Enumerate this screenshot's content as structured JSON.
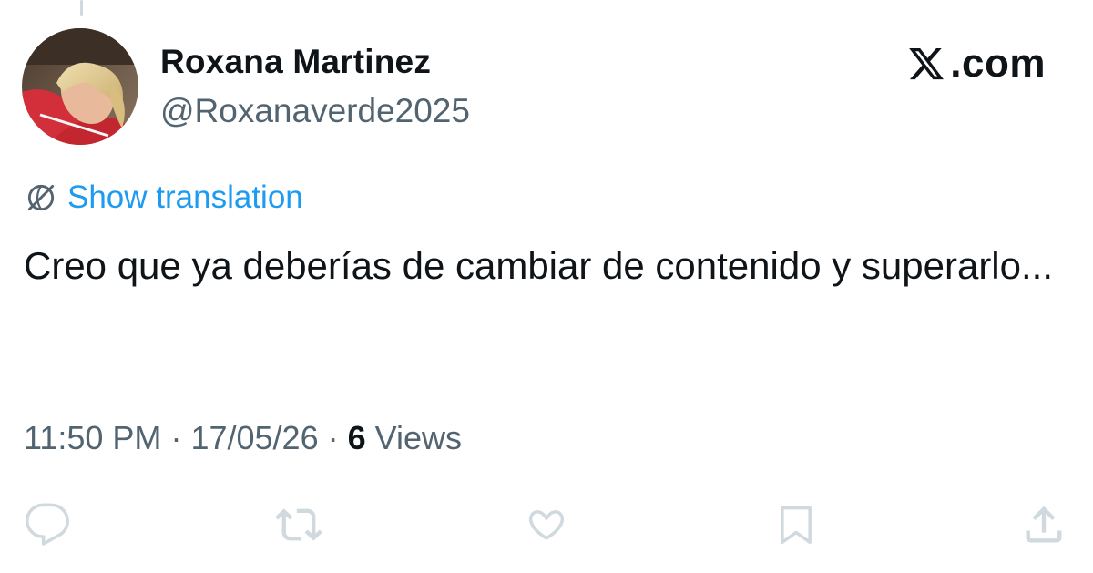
{
  "author": {
    "display_name": "Roxana Martinez",
    "handle": "@Roxanaverde2025"
  },
  "brand": {
    "text": ".com",
    "icon": "x-logo-icon"
  },
  "translation": {
    "label": "Show translation",
    "icon": "globe-translate-icon",
    "color": "#1d9bf0"
  },
  "tweet": {
    "text": "Creo que ya deberías de cambiar de contenido y superarlo..."
  },
  "meta": {
    "time": "11:50 PM",
    "separator": "·",
    "date": "17/05/26",
    "views_count": "6",
    "views_label": "Views"
  },
  "actions": [
    {
      "name": "reply",
      "icon": "reply-icon"
    },
    {
      "name": "repost",
      "icon": "repost-icon"
    },
    {
      "name": "like",
      "icon": "heart-icon"
    },
    {
      "name": "bookmark",
      "icon": "bookmark-icon"
    },
    {
      "name": "share",
      "icon": "share-icon"
    }
  ],
  "colors": {
    "text_primary": "#0f1419",
    "text_secondary": "#536471",
    "link": "#1d9bf0",
    "icon": "#cfd9de"
  }
}
